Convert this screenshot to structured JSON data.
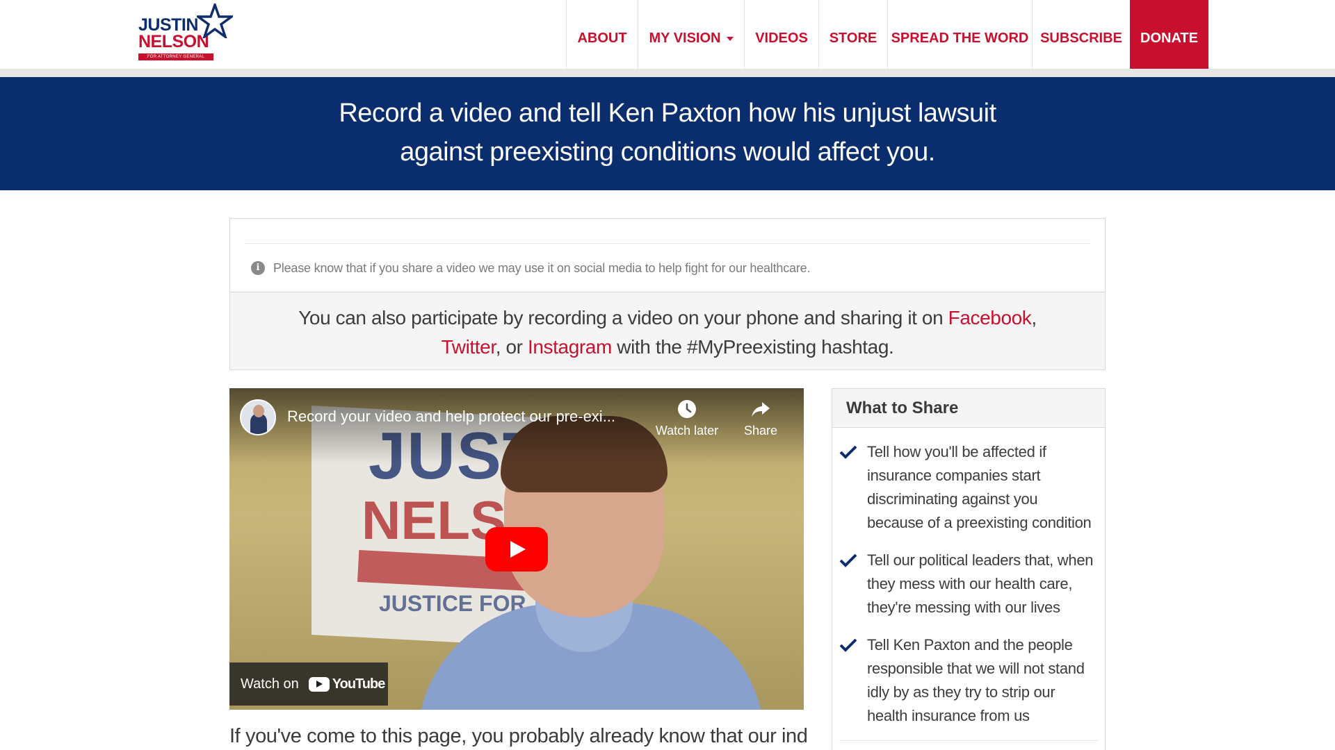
{
  "logo": {
    "line1": "JUSTIN",
    "line2": "NELSON",
    "tagline": "FOR ATTORNEY GENERAL"
  },
  "nav": {
    "about": "ABOUT",
    "my_vision": "MY VISION",
    "videos": "VIDEOS",
    "store": "STORE",
    "spread": "SPREAD THE WORD",
    "subscribe": "SUBSCRIBE",
    "donate": "DONATE"
  },
  "banner": {
    "line1": "Record a video and tell Ken Paxton how his unjust lawsuit",
    "line2": "against preexisting conditions would affect you."
  },
  "notice": {
    "text": "Please know that if you share a video we may use it on social media to help fight for our healthcare."
  },
  "participate": {
    "prefix": "You can also participate by recording a video on your phone and sharing it on ",
    "facebook": "Facebook",
    "sep1": ", ",
    "twitter": "Twitter",
    "sep2": ", or ",
    "instagram": "Instagram",
    "suffix": " with the #MyPreexisting hashtag."
  },
  "video": {
    "title": "Record your video and help protect our pre-exi...",
    "watch_later": "Watch later",
    "share": "Share",
    "watch_on": "Watch on",
    "youtube": "YouTube",
    "poster_line1": "JUST",
    "poster_line2": "NELSO",
    "poster_line3": "JUSTICE FOR"
  },
  "what_to_share": {
    "title": "What to Share",
    "items": [
      "Tell how you'll be affected if insurance companies start discriminating against you because of a preexisting condition",
      "Tell our political leaders that, when they mess with our health care, they're messing with our lives",
      "Tell Ken Paxton and the people responsible that we will not stand idly by as they try to strip our health insurance from us"
    ]
  },
  "body": {
    "paragraph": "If you've come to this page, you probably already know that our indicted"
  },
  "colors": {
    "brand_red": "#c8102e",
    "brand_navy": "#0a2d6e"
  }
}
